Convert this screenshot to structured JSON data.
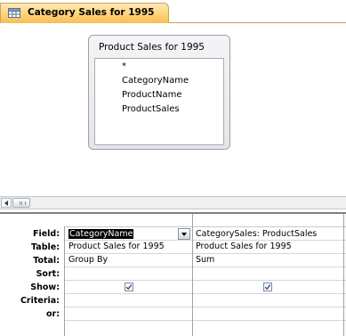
{
  "tab": {
    "title": "Category Sales for 1995",
    "icon": "query-icon"
  },
  "table_box": {
    "title": "Product Sales for 1995",
    "fields": [
      "*",
      "CategoryName",
      "ProductName",
      "ProductSales"
    ]
  },
  "grid": {
    "row_labels": [
      "Field:",
      "Table:",
      "Total:",
      "Sort:",
      "Show:",
      "Criteria:",
      "or:"
    ],
    "columns": [
      {
        "field": "CategoryName",
        "table": "Product Sales for 1995",
        "total": "Group By",
        "sort": "",
        "show": true,
        "criteria": "",
        "or": ""
      },
      {
        "field": "CategorySales: ProductSales",
        "table": "Product Sales for 1995",
        "total": "Sum",
        "sort": "",
        "show": true,
        "criteria": "",
        "or": ""
      }
    ]
  },
  "colors": {
    "tab_accent": "#ffd27a",
    "selection": "#000000"
  }
}
